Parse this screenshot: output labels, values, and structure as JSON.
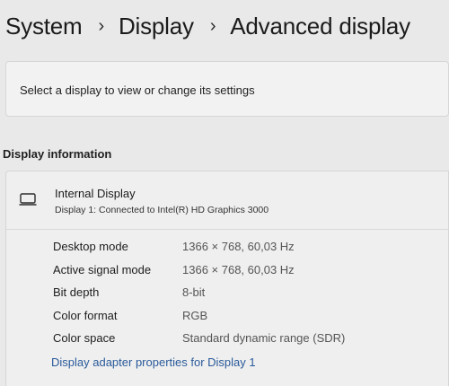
{
  "breadcrumb": [
    "System",
    "Display",
    "Advanced display"
  ],
  "select_display": {
    "label": "Select a display to view or change its settings"
  },
  "section_title": "Display information",
  "display": {
    "name": "Internal Display",
    "subtitle": "Display 1: Connected to Intel(R) HD Graphics 3000",
    "icon": "monitor-icon"
  },
  "info_rows": [
    {
      "label": "Desktop mode",
      "value": "1366 × 768, 60,03 Hz"
    },
    {
      "label": "Active signal mode",
      "value": "1366 × 768, 60,03 Hz"
    },
    {
      "label": "Bit depth",
      "value": "8-bit"
    },
    {
      "label": "Color format",
      "value": "RGB"
    },
    {
      "label": "Color space",
      "value": "Standard dynamic range (SDR)"
    }
  ],
  "adapter_link": "Display adapter properties for Display 1",
  "colors": {
    "background": "#e9e9ea",
    "card": "#efefef",
    "link": "#2a5a9a"
  }
}
